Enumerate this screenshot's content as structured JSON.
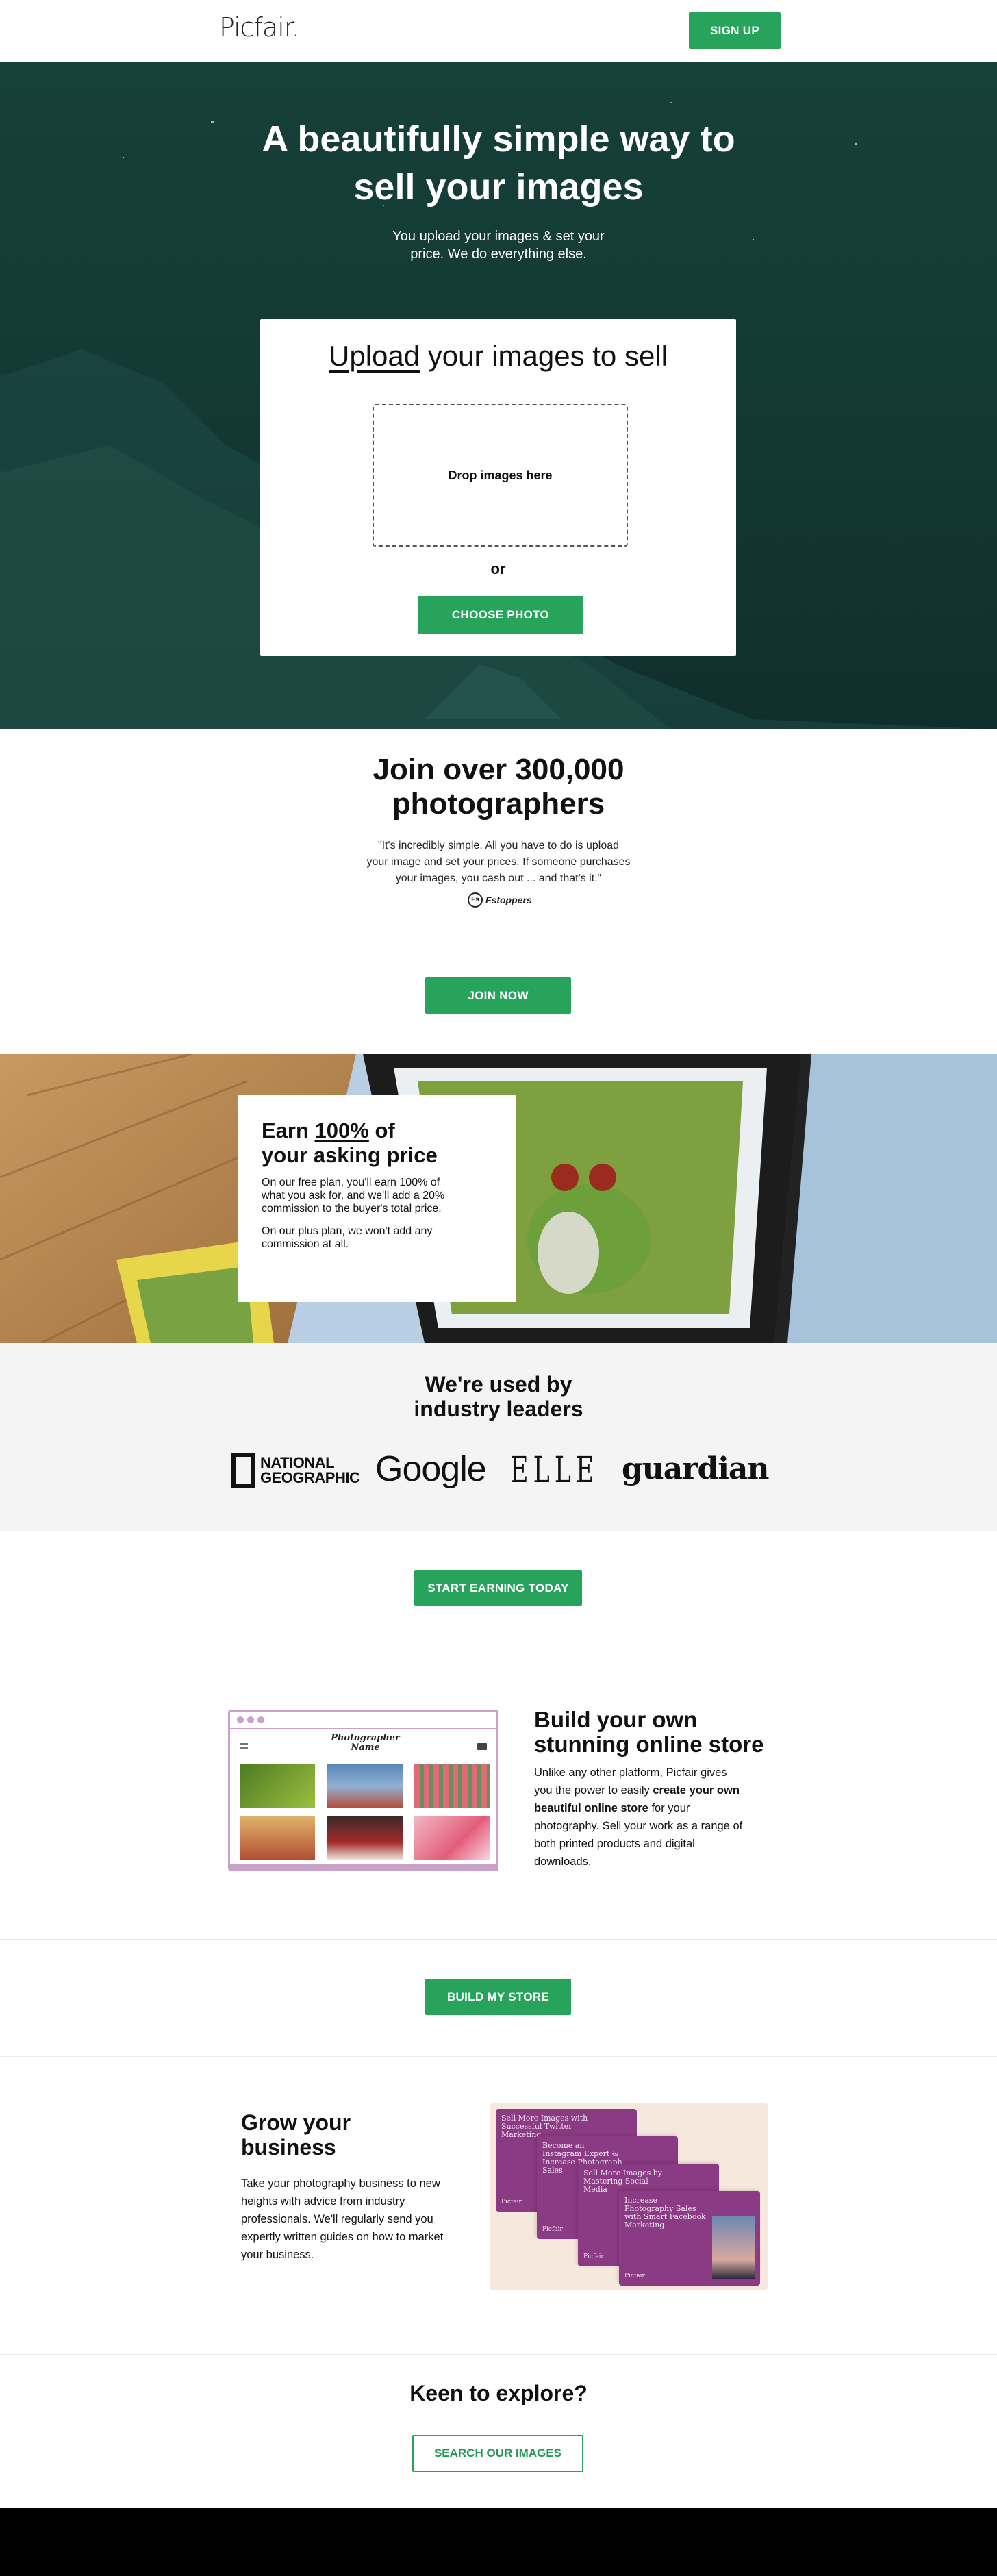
{
  "header": {
    "logo": "Picfair.",
    "signup": "SIGN UP"
  },
  "hero": {
    "title_line1": "A beautifully simple way to",
    "title_line2": "sell your images",
    "subtitle_line1": "You upload your images & set your",
    "subtitle_line2": "price. We do everything else.",
    "upload_title_underlined": "Upload",
    "upload_title_rest": " your images to sell",
    "drop_text": "Drop images here",
    "or": "or",
    "choose_photo": "CHOOSE PHOTO"
  },
  "join": {
    "title_line1": "Join over 300,000",
    "title_line2": "photographers",
    "quote_line1": "\"It's incredibly simple. All you have to do is upload",
    "quote_line2": "your image and set your prices. If someone purchases",
    "quote_line3": "your images, you cash out ... and that's it.\"",
    "source_logo": "Fstoppers",
    "join_now": "JOIN NOW"
  },
  "earn": {
    "title_prefix": "Earn ",
    "title_highlight": "100%",
    "title_suffix": " of",
    "title_line2": "your asking price",
    "para1_line1": "On our free plan, you'll earn 100% of",
    "para1_line2": "what you ask for, and we'll add a 20%",
    "para1_line3": "commission to the buyer's total price.",
    "para2_line1": "On our plus plan, we won't add any",
    "para2_line2": "commission at all."
  },
  "leaders": {
    "title_line1": "We're used by",
    "title_line2": "industry leaders",
    "logos": [
      "NATIONAL",
      "GEOGRAPHIC",
      "Google",
      "ELLE",
      "guardian"
    ],
    "cta": "START EARNING TODAY"
  },
  "store": {
    "title_line1": "Build your own",
    "title_line2": "stunning online store",
    "text_a": "Unlike any other platform, Picfair gives you the power to easily ",
    "text_bold": "create your own beautiful online store",
    "text_b": " for your photography. Sell your work as a range of both printed products and digital downloads.",
    "mock_name_line1": "Photographer",
    "mock_name_line2": "Name",
    "cta": "BUILD MY STORE"
  },
  "grow": {
    "title_line1": "Grow your",
    "title_line2": "business",
    "text": "Take your photography business to new heights with advice from industry professionals. We'll regularly send you expertly written guides on how to market your business.",
    "cards": [
      {
        "title": "Sell More Images with Successful Twitter Marketing",
        "tag": "Picfair"
      },
      {
        "title": "Become an Instagram Expert & Increase Photograph Sales",
        "tag": "Picfair"
      },
      {
        "title": "Sell More Images by Mastering Social Media",
        "tag": "Picfair"
      },
      {
        "title": "Increase Photography Sales with Smart Facebook Marketing",
        "tag": "Picfair"
      }
    ]
  },
  "explore": {
    "title": "Keen to explore?",
    "cta": "SEARCH OUR IMAGES"
  },
  "colors": {
    "accent": "#27a35b",
    "hero_bg": "#163a36",
    "purple": "#8b3b83",
    "footer": "#000000"
  }
}
